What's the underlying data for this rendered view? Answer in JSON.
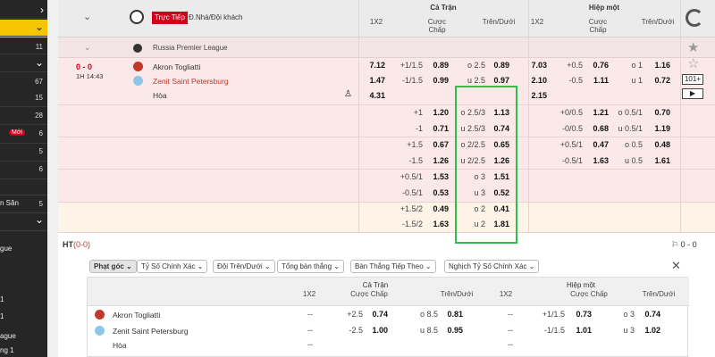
{
  "sidebar": {
    "rows": [
      {
        "text": "",
        "num": "",
        "chev": "›"
      },
      {
        "text": "",
        "num": "",
        "chev": "⌄"
      },
      {
        "text": "",
        "num": "11",
        "chev": ""
      },
      {
        "text": "",
        "num": "",
        "chev": "⌄"
      },
      {
        "text": "",
        "num": "67",
        "chev": ""
      },
      {
        "text": "",
        "num": "15",
        "chev": ""
      },
      {
        "text": "",
        "num": "28",
        "chev": ""
      },
      {
        "text": "",
        "num": "6",
        "chev": "",
        "badge": "Mới"
      },
      {
        "text": "",
        "num": "5",
        "chev": ""
      },
      {
        "text": "",
        "num": "6",
        "chev": ""
      },
      {
        "text": "n Săn",
        "num": "5",
        "chev": ""
      },
      {
        "text": "",
        "num": "",
        "chev": "⌄"
      },
      {
        "text": "gue",
        "num": "",
        "chev": ""
      },
      {
        "text": "1",
        "num": "",
        "chev": ""
      },
      {
        "text": "1",
        "num": "",
        "chev": ""
      },
      {
        "text": "ague",
        "num": "",
        "chev": ""
      },
      {
        "text": "ng 1",
        "num": "",
        "chev": ""
      }
    ]
  },
  "header": {
    "live": "Trực Tiếp",
    "home_away": "Đ.Nhà/Đội khách",
    "full_time": "Cả Trận",
    "first_half": "Hiệp một",
    "col_1x2": "1X2",
    "col_handicap": "Cược Chấp",
    "col_ou": "Trên/Dưới"
  },
  "league": {
    "name": "Russia Premier League"
  },
  "match": {
    "score": "0 - 0",
    "time": "1H 14:43",
    "home": "Akron Togliatti",
    "away": "Zenit Saint Petersburg",
    "draw": "Hòa",
    "more": "101+",
    "play": "▶"
  },
  "rows": [
    {
      "ft1x2": "7.12",
      "fthl": "+1/1.5",
      "fthv": "0.89",
      "ftol": "o 2.5",
      "ftov": "0.89",
      "h11x2": "7.03",
      "h1hl": "+0.5",
      "h1hv": "0.76",
      "h1ol": "o 1",
      "h1ov": "1.16"
    },
    {
      "ft1x2": "1.47",
      "fthl": "-1/1.5",
      "fthv": "0.99",
      "ftol": "u 2.5",
      "ftov": "0.97",
      "h11x2": "2.10",
      "h1hl": "-0.5",
      "h1hv": "1.11",
      "h1ol": "u 1",
      "h1ov": "0.72"
    },
    {
      "ft1x2": "4.31",
      "fthl": "",
      "fthv": "",
      "ftol": "",
      "ftov": "",
      "h11x2": "2.15",
      "h1hl": "",
      "h1hv": "",
      "h1ol": "",
      "h1ov": ""
    },
    {
      "ft1x2": "",
      "fthl": "+1",
      "fthv": "1.20",
      "ftol": "o 2.5/3",
      "ftov": "1.13",
      "h11x2": "",
      "h1hl": "+0/0.5",
      "h1hv": "1.21",
      "h1ol": "o 0.5/1",
      "h1ov": "0.70"
    },
    {
      "ft1x2": "",
      "fthl": "-1",
      "fthv": "0.71",
      "ftol": "u 2.5/3",
      "ftov": "0.74",
      "h11x2": "",
      "h1hl": "-0/0.5",
      "h1hv": "0.68",
      "h1ol": "u 0.5/1",
      "h1ov": "1.19"
    },
    {
      "ft1x2": "",
      "fthl": "+1.5",
      "fthv": "0.67",
      "ftol": "o 2/2.5",
      "ftov": "0.65",
      "h11x2": "",
      "h1hl": "+0.5/1",
      "h1hv": "0.47",
      "h1ol": "o 0.5",
      "h1ov": "0.48"
    },
    {
      "ft1x2": "",
      "fthl": "-1.5",
      "fthv": "1.26",
      "ftol": "u 2/2.5",
      "ftov": "1.26",
      "h11x2": "",
      "h1hl": "-0.5/1",
      "h1hv": "1.63",
      "h1ol": "u 0.5",
      "h1ov": "1.61"
    },
    {
      "ft1x2": "",
      "fthl": "+0.5/1",
      "fthv": "1.53",
      "ftol": "o 3",
      "ftov": "1.51",
      "h11x2": "",
      "h1hl": "",
      "h1hv": "",
      "h1ol": "",
      "h1ov": ""
    },
    {
      "ft1x2": "",
      "fthl": "-0.5/1",
      "fthv": "0.53",
      "ftol": "u 3",
      "ftov": "0.52",
      "h11x2": "",
      "h1hl": "",
      "h1hv": "",
      "h1ol": "",
      "h1ov": ""
    },
    {
      "ft1x2": "",
      "fthl": "+1.5/2",
      "fthv": "0.49",
      "ftol": "o 2",
      "ftov": "0.41",
      "h11x2": "",
      "h1hl": "",
      "h1hv": "",
      "h1ol": "",
      "h1ov": ""
    },
    {
      "ft1x2": "",
      "fthl": "-1.5/2",
      "fthv": "1.63",
      "ftol": "u 2",
      "ftov": "1.81",
      "h11x2": "",
      "h1hl": "",
      "h1hv": "",
      "h1ol": "",
      "h1ov": ""
    }
  ],
  "ht": {
    "label": "HT",
    "score": "(0-0)",
    "right": "⚐ 0 - 0"
  },
  "tabs": [
    {
      "label": "Phạt góc ⌄",
      "active": true
    },
    {
      "label": "Tỷ Số Chính Xác ⌄",
      "active": false
    },
    {
      "label": "Đội Trên/Dưới ⌄",
      "active": false
    },
    {
      "label": "Tổng bàn thắng ⌄",
      "active": false
    },
    {
      "label": "Bàn Thắng Tiếp Theo ⌄",
      "active": false
    },
    {
      "label": "Nghịch Tỷ Số Chính Xác ⌄",
      "active": false
    }
  ],
  "detail": {
    "full_time": "Cả Trận",
    "first_half": "Hiệp một",
    "col_1x2": "1X2",
    "col_handicap": "Cược Chấp",
    "col_ou": "Trên/Dưới",
    "home": "Akron Togliatti",
    "away": "Zenit Saint Petersburg",
    "draw": "Hòa",
    "rows": [
      {
        "ft1x2": "--",
        "fthl": "+2.5",
        "fthv": "0.74",
        "ftol": "o 8.5",
        "ftov": "0.81",
        "h11x2": "--",
        "h1hl": "+1/1.5",
        "h1hv": "0.73",
        "h1ol": "o 3",
        "h1ov": "0.74"
      },
      {
        "ft1x2": "--",
        "fthl": "-2.5",
        "fthv": "1.00",
        "ftol": "u 8.5",
        "ftov": "0.95",
        "h11x2": "--",
        "h1hl": "-1/1.5",
        "h1hv": "1.01",
        "h1ol": "u 3",
        "h1ov": "1.02"
      },
      {
        "ft1x2": "--",
        "fthl": "",
        "fthv": "",
        "ftol": "",
        "ftov": "",
        "h11x2": "--",
        "h1hl": "",
        "h1hv": "",
        "h1ol": "",
        "h1ov": ""
      }
    ]
  },
  "colors": {
    "accent": "#d0021b",
    "highlight": "#2fbf4a",
    "sidebar": "#262626",
    "row_bg": "#fbe9e9"
  }
}
